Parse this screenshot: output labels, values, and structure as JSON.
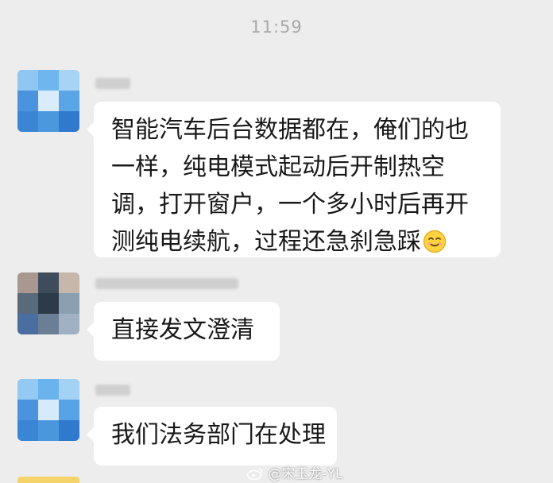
{
  "timestamp": "11:59",
  "messages": [
    {
      "lines": [
        "智能汽车后台数据都在，俺们的也",
        "一样，纯电模式起动后开制热空",
        "调，打开窗户，一个多小时后再开",
        "测纯电续航，过程还急刹急踩"
      ],
      "emoji": "smiling-face-icon"
    },
    {
      "text": "直接发文澄清"
    },
    {
      "text": "我们法务部门在处理"
    }
  ],
  "watermark": {
    "text": "@宋玉龙-YL",
    "icon": "weibo-icon"
  },
  "colors": {
    "background": "#ededed",
    "bubble": "#ffffff",
    "text": "#191919",
    "timestamp": "#a8a8a8"
  }
}
